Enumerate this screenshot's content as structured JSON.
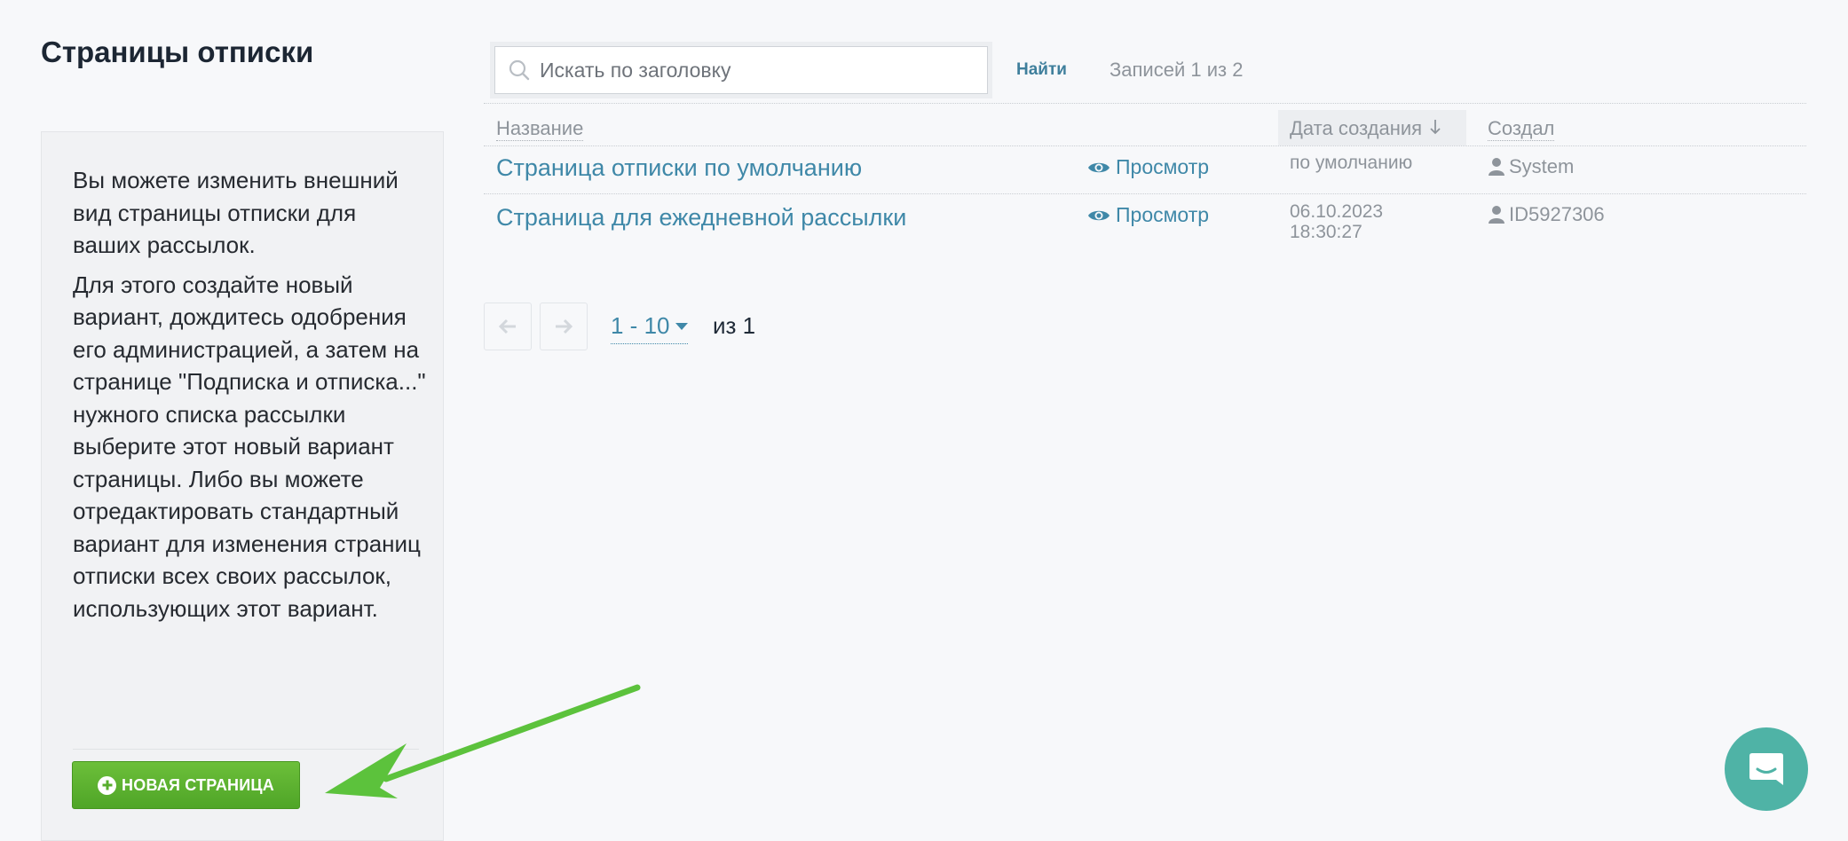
{
  "page": {
    "title": "Страницы отписки"
  },
  "info": {
    "paragraph1": "Вы можете изменить внешний вид страницы отписки для ваших рассылок.",
    "paragraph2": "Для этого создайте новый вариант, дождитесь одобрения его администрацией, а затем на странице \"Подписка и отписка...\" нужного списка рассылки выберите этот новый вариант страницы. Либо вы можете отредактировать стандартный вариант для изменения страниц отписки всех своих рассылок, использующих этот вариант.",
    "new_page_button": "НОВАЯ СТРАНИЦА"
  },
  "search": {
    "placeholder": "Искать по заголовку",
    "value": "",
    "find_button": "Найти",
    "records_count": "Записей 1 из 2"
  },
  "table": {
    "headers": {
      "name": "Название",
      "date": "Дата создания",
      "date_sort_icon": "arrow-down-icon",
      "author": "Создал"
    },
    "rows": [
      {
        "title": "Страница отписки по умолчанию",
        "view_label": "Просмотр",
        "date_line1": "по умолчанию",
        "date_line2": "",
        "author": "System"
      },
      {
        "title": "Страница для ежедневной рассылки",
        "view_label": "Просмотр",
        "date_line1": "06.10.2023",
        "date_line2": "18:30:27",
        "author": "ID5927306"
      }
    ]
  },
  "pagination": {
    "range": "1 - 10",
    "total": "из 1"
  },
  "colors": {
    "accent_link": "#3f88a8",
    "button_green": "#5cb431",
    "annotation_arrow": "#5cc23c",
    "chat_teal": "#4fb3a6"
  }
}
